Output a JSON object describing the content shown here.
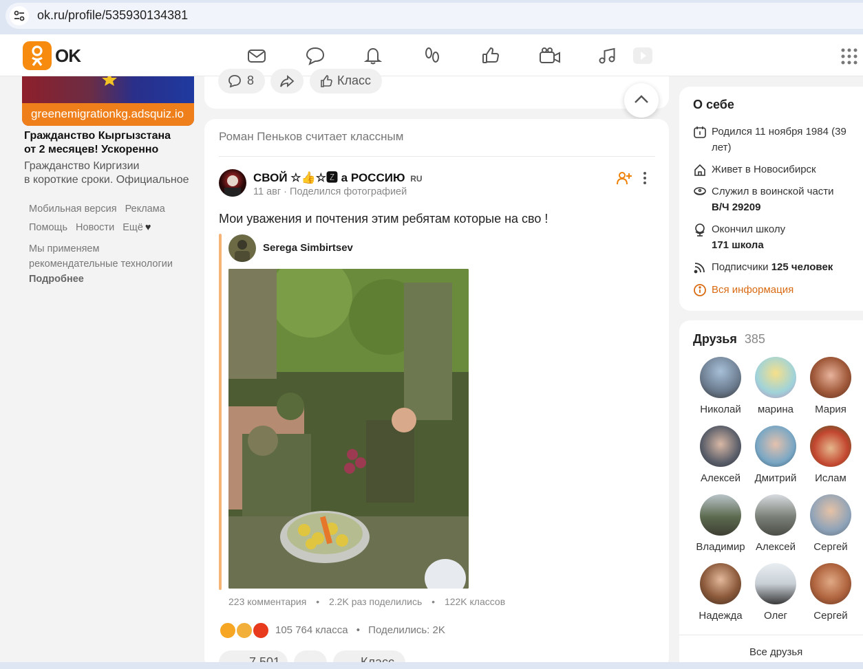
{
  "browser": {
    "url": "ok.ru/profile/535930134381"
  },
  "header": {
    "logo_text": "OK"
  },
  "ad": {
    "domain": "greenemigrationkg.adsquiz.io",
    "title_line1": "Гражданство Кыргызстана",
    "title_line2": "от 2 месяцев! Ускоренно",
    "desc_line1": "Гражданство Киргизии",
    "desc_line2": "в короткие сроки. Официальное"
  },
  "footer": {
    "mobile": "Мобильная версия",
    "ads": "Реклама",
    "help": "Помощь",
    "news": "Новости",
    "more": "Ещё",
    "rec_line1": "Мы применяем",
    "rec_line2": "рекомендательные технологии",
    "details": "Подробнее"
  },
  "prev_post": {
    "comments": "8",
    "klass": "Класс"
  },
  "feed": {
    "header": "Роман Пеньков считает классным",
    "author": "СВОЙ ☆👍☆🆉 а РОССИЮ",
    "author_badge": "RU",
    "date": "11 авг",
    "action": "Поделился фотографией",
    "text": "Мои уважения и почтения этим ребятам которые на сво !",
    "repost_author": "Serega Simbirtsev",
    "stats_comments": "223 комментария",
    "stats_shares": "2.2K раз поделились",
    "stats_klass": "122K классов",
    "likes_count": "105 764 класса",
    "shares": "Поделились: 2K",
    "bottom_comments": "7 501",
    "bottom_klass": "Класс"
  },
  "about": {
    "title": "О себе",
    "born": "Родился 11 ноября 1984 (39 лет)",
    "lives": "Живет в Новосибирск",
    "served_prefix": "Служил в воинской части",
    "served_unit": "В/Ч 29209",
    "school_prefix": "Окончил школу",
    "school_name": "171 школа",
    "subs_prefix": "Подписчики",
    "subs_count": "125 человек",
    "all_info": "Вся информация"
  },
  "friends": {
    "title": "Друзья",
    "count": "385",
    "all": "Все друзья",
    "list": [
      {
        "name": "Николай"
      },
      {
        "name": "марина"
      },
      {
        "name": "Мария"
      },
      {
        "name": "Алексей"
      },
      {
        "name": "Дмитрий"
      },
      {
        "name": "Ислам"
      },
      {
        "name": "Владимир"
      },
      {
        "name": "Алексей"
      },
      {
        "name": "Сергей"
      },
      {
        "name": "Надежда"
      },
      {
        "name": "Олег"
      },
      {
        "name": "Сергей"
      }
    ]
  },
  "colors": {
    "brand": "#f78b10",
    "link": "#d96a12"
  }
}
